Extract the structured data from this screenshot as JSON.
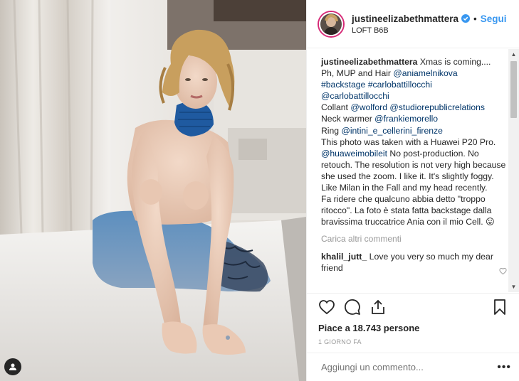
{
  "header": {
    "username": "justineelizabethmattera",
    "follow_label": "Segui",
    "separator": "•",
    "location": "LOFT B6B"
  },
  "caption": {
    "username": "justineelizabethmattera",
    "lines": [
      {
        "parts": [
          {
            "t": " Xmas is coming....",
            "k": "text"
          }
        ]
      },
      {
        "parts": [
          {
            "t": "Ph, MUP and Hair ",
            "k": "text"
          },
          {
            "t": "@aniamelnikova",
            "k": "link"
          }
        ]
      },
      {
        "parts": [
          {
            "t": "#backstage",
            "k": "link"
          },
          {
            "t": " ",
            "k": "text"
          },
          {
            "t": "#carlobattillocchi",
            "k": "link"
          }
        ]
      },
      {
        "parts": [
          {
            "t": "@carlobattillocchi",
            "k": "link"
          }
        ]
      },
      {
        "parts": [
          {
            "t": "Collant ",
            "k": "text"
          },
          {
            "t": "@wolford",
            "k": "link"
          },
          {
            "t": " ",
            "k": "text"
          },
          {
            "t": "@studiorepublicrelations",
            "k": "link"
          }
        ]
      },
      {
        "parts": [
          {
            "t": "Neck warmer ",
            "k": "text"
          },
          {
            "t": "@frankiemorello",
            "k": "link"
          }
        ]
      },
      {
        "parts": [
          {
            "t": "Ring ",
            "k": "text"
          },
          {
            "t": "@intini_e_cellerini_firenze",
            "k": "link"
          }
        ]
      },
      {
        "parts": [
          {
            "t": "This photo was taken with a Huawei P20 Pro. ",
            "k": "text"
          },
          {
            "t": "@huaweimobileit",
            "k": "link"
          },
          {
            "t": " No post-production. No retouch. The resolution is not very high because she used the zoom. I like it. It's slightly foggy. Like Milan in the Fall and my head recently.",
            "k": "text"
          }
        ]
      },
      {
        "parts": [
          {
            "t": "Fa ridere che qualcuno abbia detto \"troppo ritocco\". La foto è stata fatta backstage dalla bravissima truccatrice Ania con il mio Cell. 😛",
            "k": "text"
          }
        ]
      }
    ]
  },
  "load_more_label": "Carica altri commenti",
  "comments": [
    {
      "username": "khalil_jutt_",
      "text": " Love you very so much my dear friend"
    }
  ],
  "likes_text": "Piace a 18.743 persone",
  "time_text": "1 GIORNO FA",
  "add_comment_placeholder": "Aggiungi un commento...",
  "more_options_label": "•••",
  "icons": {
    "verified": "verified-badge-icon",
    "like": "heart-icon",
    "comment": "comment-icon",
    "share": "share-icon",
    "save": "bookmark-icon",
    "tag": "user-tag-icon"
  },
  "colors": {
    "link": "#003569",
    "follow": "#3897f0",
    "muted": "#999999",
    "text": "#262626"
  }
}
